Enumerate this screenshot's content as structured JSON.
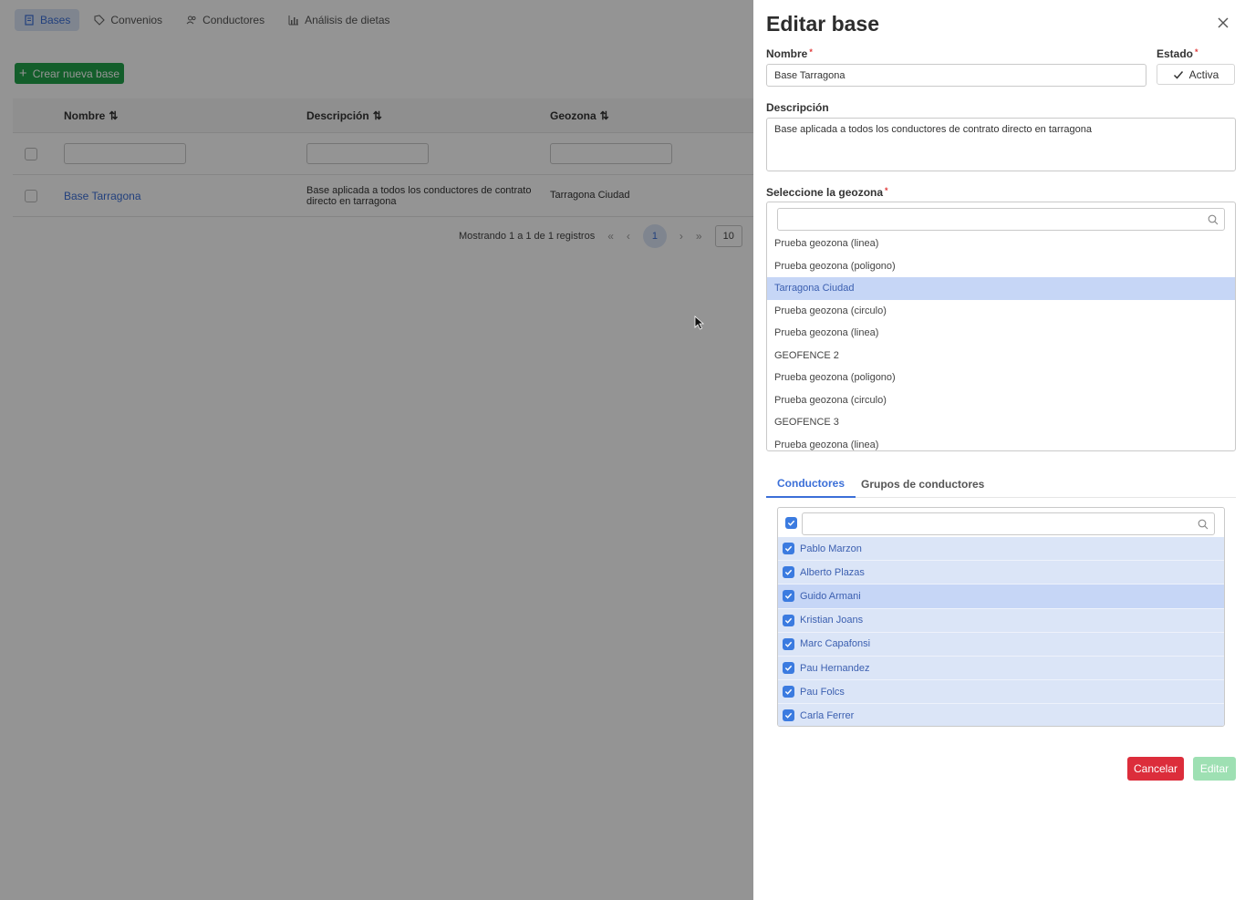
{
  "nav": {
    "items": [
      {
        "label": "Bases",
        "icon": "building-icon",
        "active": true
      },
      {
        "label": "Convenios",
        "icon": "tag-icon",
        "active": false
      },
      {
        "label": "Conductores",
        "icon": "users-icon",
        "active": false
      },
      {
        "label": "Análisis de dietas",
        "icon": "bar-chart-icon",
        "active": false
      }
    ]
  },
  "toolbar": {
    "create_label": "Crear nueva base"
  },
  "table": {
    "columns": [
      "Nombre",
      "Descripción",
      "Geozona"
    ],
    "rows": [
      {
        "nombre": "Base Tarragona",
        "descripcion_line1": "Base aplicada a todos los conductores de contrato",
        "descripcion_line2": "directo en tarragona",
        "geozona": "Tarragona Ciudad"
      }
    ]
  },
  "pager": {
    "summary": "Mostrando 1 a 1 de 1 registros",
    "first": "«",
    "prev": "‹",
    "current": "1",
    "next": "›",
    "last": "»",
    "per_page": "10"
  },
  "panel": {
    "title": "Editar base",
    "nombre_label": "Nombre",
    "nombre_value": "Base Tarragona",
    "estado_label": "Estado",
    "estado_value": "Activa",
    "descripcion_label": "Descripción",
    "descripcion_value": "Base aplicada a todos los conductores de contrato directo en tarragona",
    "geozona_label": "Seleccione la geozona",
    "required_mark": "*",
    "geozonas": [
      {
        "label": "Prueba geozona (linea)",
        "selected": false
      },
      {
        "label": "Prueba geozona (poligono)",
        "selected": false
      },
      {
        "label": "Tarragona Ciudad",
        "selected": true
      },
      {
        "label": "Prueba geozona (circulo)",
        "selected": false
      },
      {
        "label": "Prueba geozona (linea)",
        "selected": false
      },
      {
        "label": "GEOFENCE 2",
        "selected": false
      },
      {
        "label": "Prueba geozona (poligono)",
        "selected": false
      },
      {
        "label": "Prueba geozona (circulo)",
        "selected": false
      },
      {
        "label": "GEOFENCE 3",
        "selected": false
      },
      {
        "label": "Prueba geozona (linea)",
        "selected": false
      }
    ],
    "tabs": [
      {
        "label": "Conductores",
        "active": true
      },
      {
        "label": "Grupos de conductores",
        "active": false
      }
    ],
    "conductores": [
      {
        "name": "Pablo Marzon",
        "checked": true
      },
      {
        "name": "Alberto Plazas",
        "checked": true
      },
      {
        "name": "Guido Armani",
        "checked": true
      },
      {
        "name": "Kristian Joans",
        "checked": true
      },
      {
        "name": "Marc Capafonsi",
        "checked": true
      },
      {
        "name": "Pau Hernandez",
        "checked": true
      },
      {
        "name": "Pau Folcs",
        "checked": true
      },
      {
        "name": "Carla Ferrer",
        "checked": true
      }
    ],
    "cancel_label": "Cancelar",
    "edit_label": "Editar"
  },
  "colors": {
    "accent": "#3b6fd8",
    "success": "#22a34a",
    "danger": "#dc2d3b",
    "selected": "#c6d6f6"
  }
}
